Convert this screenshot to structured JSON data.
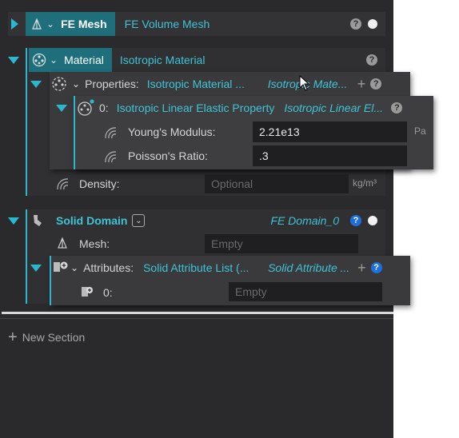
{
  "colors": {
    "accent": "#29b8d0",
    "link": "#3fc3d6",
    "panel": "#333335",
    "field": "#1f1f21",
    "help_active": "#1d6fe0"
  },
  "fe_mesh": {
    "label": "FE Mesh",
    "value": "FE Volume Mesh",
    "help": "?"
  },
  "material": {
    "label": "Material",
    "value": "Isotropic Material",
    "help": "?",
    "properties": {
      "label": "Properties:",
      "value": "Isotropic Material ...",
      "type": "Isotropic Mate...",
      "help": "?",
      "item": {
        "index": "0:",
        "value": "Isotropic Linear Elastic Property",
        "type": "Isotropic Linear El...",
        "help": "?",
        "youngs_label": "Young's Modulus:",
        "youngs_value": "2.21e13",
        "youngs_unit": "Pa",
        "poisson_label": "Poisson's Ratio:",
        "poisson_value": ".3"
      }
    },
    "density_label": "Density:",
    "density_placeholder": "Optional",
    "density_unit": "kg/m³"
  },
  "solid_domain": {
    "label": "Solid Domain",
    "value": "FE Domain_0",
    "help": "?",
    "mesh_label": "Mesh:",
    "mesh_placeholder": "Empty",
    "attributes": {
      "label": "Attributes:",
      "value": "Solid Attribute List (...",
      "type": "Solid Attribute ...",
      "help": "?",
      "item_index": "0:",
      "item_placeholder": "Empty"
    }
  },
  "new_section": "New Section"
}
